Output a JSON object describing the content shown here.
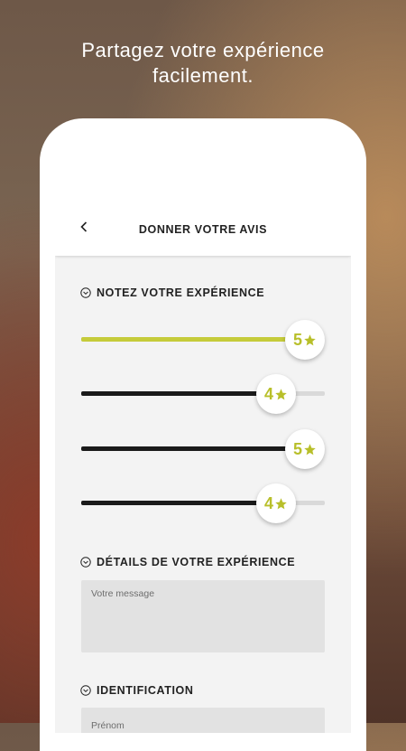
{
  "headline": {
    "line1": "Partagez votre expérience",
    "line2": "facilement."
  },
  "appbar": {
    "back_icon": "chevron-left-icon",
    "title": "DONNER VOTRE AVIS"
  },
  "rating_section": {
    "title": "NOTEZ VOTRE EXPÉRIENCE",
    "icon": "chevron-circle-down-icon",
    "max": 5,
    "sliders": [
      {
        "value": 5,
        "display": "5",
        "fill_color": "#c5cb3a"
      },
      {
        "value": 4,
        "display": "4",
        "fill_color": "#1a1a1a"
      },
      {
        "value": 5,
        "display": "5",
        "fill_color": "#1a1a1a"
      },
      {
        "value": 4,
        "display": "4",
        "fill_color": "#1a1a1a"
      }
    ]
  },
  "details_section": {
    "title": "DÉTAILS DE VOTRE EXPÉRIENCE",
    "icon": "chevron-circle-down-icon",
    "message_placeholder": "Votre message",
    "message_value": ""
  },
  "identification_section": {
    "title": "IDENTIFICATION",
    "icon": "chevron-circle-down-icon",
    "firstname_placeholder": "Prénom",
    "firstname_value": ""
  },
  "colors": {
    "accent": "#b8bf2a",
    "star": "#b8bf2a",
    "track": "#d9d9d9",
    "screen_bg": "#f3f3f3"
  }
}
